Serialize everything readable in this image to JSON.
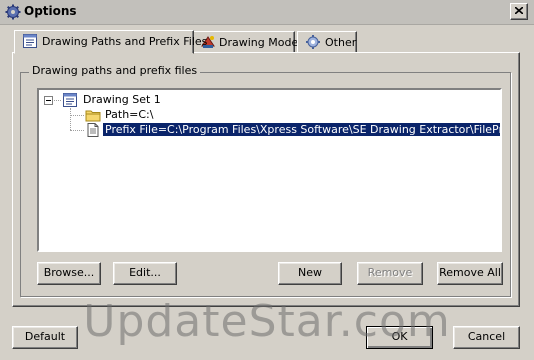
{
  "window": {
    "title": "Options"
  },
  "tabs": [
    {
      "label": "Drawing Paths and Prefix Files",
      "icon": "drawing-set-icon",
      "active": true
    },
    {
      "label": "Drawing Mode",
      "icon": "drawing-mode-icon",
      "active": false
    },
    {
      "label": "Other",
      "icon": "gear-icon",
      "active": false
    }
  ],
  "group": {
    "label": "Drawing paths and prefix files"
  },
  "tree": {
    "root": {
      "label": "Drawing Set 1",
      "icon": "drawing-set-icon",
      "expanded": true
    },
    "children": [
      {
        "label": "Path=C:\\",
        "icon": "folder-icon",
        "selected": false
      },
      {
        "label": "Prefix File=C:\\Program Files\\Xpress Software\\SE Drawing Extractor\\FilePrefixes.txt",
        "icon": "file-icon",
        "selected": true
      }
    ]
  },
  "buttons": {
    "browse": "Browse...",
    "edit": "Edit...",
    "new": "New",
    "remove": "Remove",
    "remove_all": "Remove All",
    "default": "Default",
    "ok": "OK",
    "cancel": "Cancel"
  },
  "watermark": "UpdateStar.com",
  "colors": {
    "selection": "#0a246a",
    "face": "#d4d0c8"
  }
}
